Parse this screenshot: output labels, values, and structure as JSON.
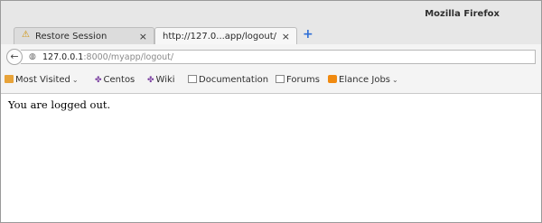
{
  "window": {
    "title": "Mozilla Firefox"
  },
  "tabs": [
    {
      "label": "Restore Session",
      "icon": "warning-icon",
      "close": "×"
    },
    {
      "label": "http://127.0...app/logout/",
      "close": "×"
    }
  ],
  "new_tab_label": "+",
  "nav": {
    "back_glyph": "←",
    "url_host": "127.0.0.1",
    "url_rest": ":8000/myapp/logout/"
  },
  "bookmarks": [
    {
      "label": "Most Visited",
      "icon": "folder-icon",
      "caret": "⌄"
    },
    {
      "label": "Centos",
      "icon": "centos-icon"
    },
    {
      "label": "Wiki",
      "icon": "centos-icon"
    },
    {
      "label": "Documentation",
      "icon": "page-icon"
    },
    {
      "label": "Forums",
      "icon": "page-icon"
    },
    {
      "label": "Elance Jobs",
      "icon": "rss-icon",
      "caret": "⌄"
    }
  ],
  "content": {
    "message": "You are logged out."
  },
  "colors": {
    "accent": "#2f6fd6",
    "chrome": "#e7e7e7"
  }
}
